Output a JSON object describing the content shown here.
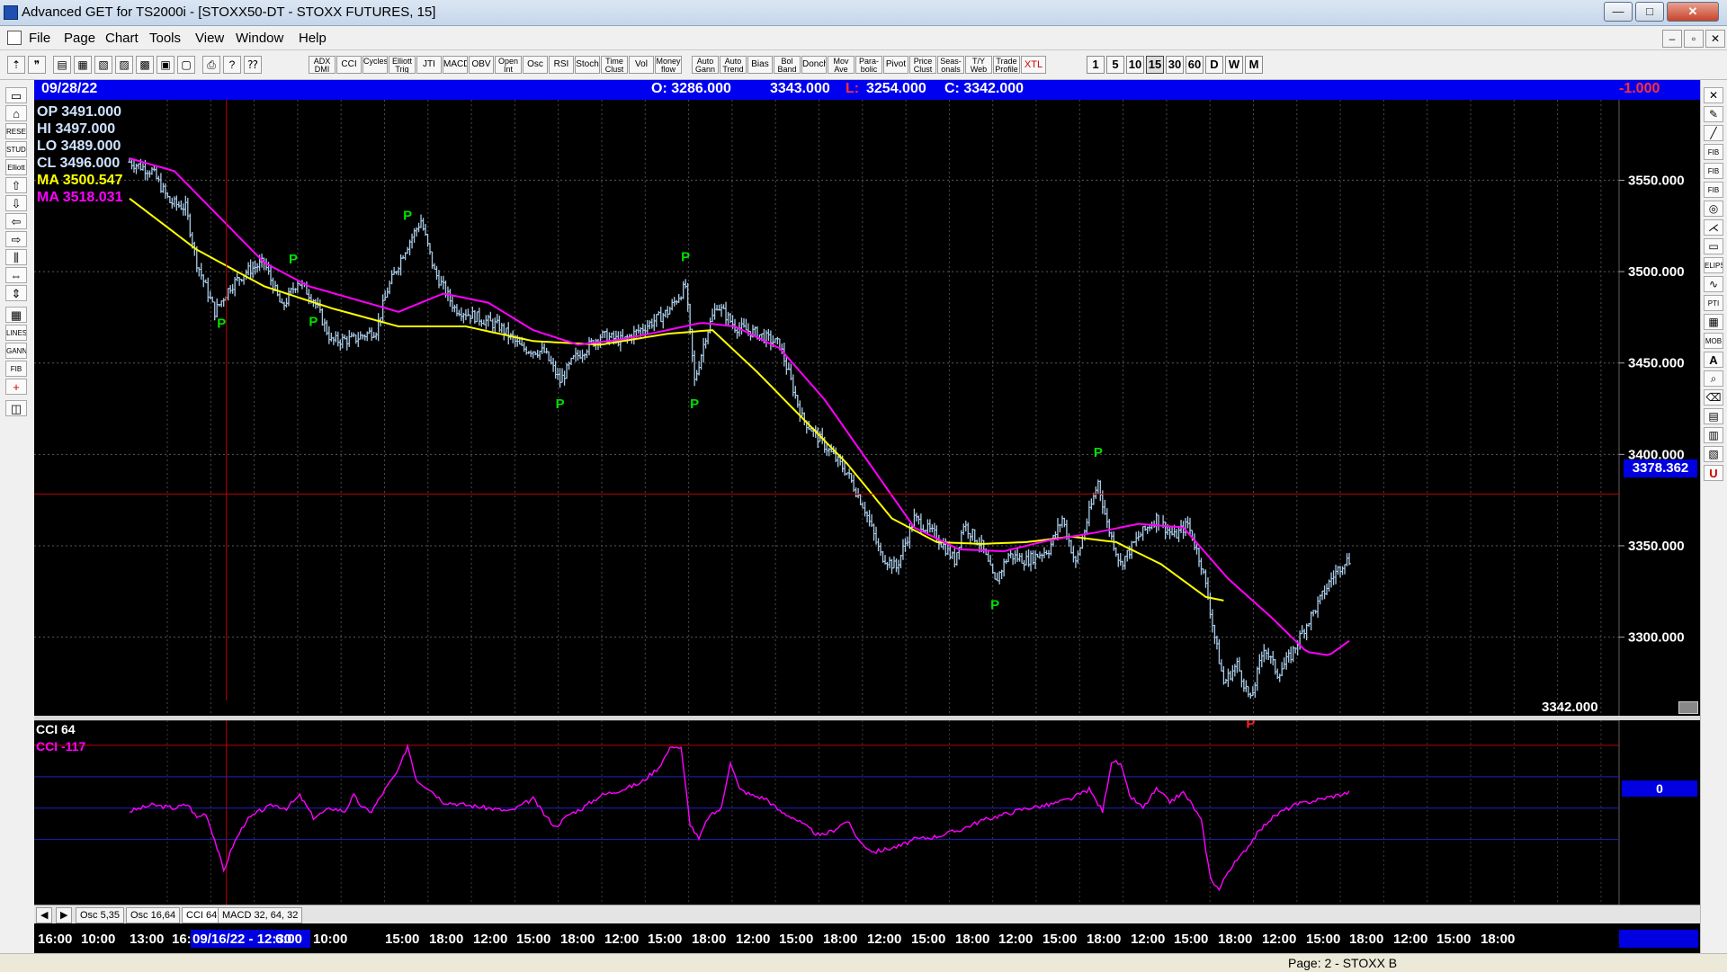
{
  "window": {
    "title": "Advanced GET for TS2000i - [STOXX50-DT - STOXX FUTURES, 15]",
    "minimize": "—",
    "maximize": "□",
    "close": "✕"
  },
  "menu": [
    "File",
    "Page",
    "Chart",
    "Tools",
    "View",
    "Window",
    "Help"
  ],
  "toolbar": {
    "study_buttons": [
      "ADX DMI",
      "CCI",
      "Cycles",
      "Elliott Trig",
      "JTI",
      "MACD",
      "OBV",
      "Open Int",
      "Osc",
      "RSI",
      "Stoch",
      "Time Clust",
      "Vol",
      "Money flow",
      "Auto Gann",
      "Auto Trend",
      "Bias",
      "Bol Band",
      "Donch",
      "Mov Ave",
      "Para- bolic",
      "Pivot",
      "Price Clust",
      "Seas- onals",
      "T/Y Web",
      "Trade Profile",
      "XTL"
    ],
    "periods": [
      "1",
      "5",
      "10",
      "15",
      "30",
      "60",
      "D",
      "W",
      "M"
    ]
  },
  "left_tools": [
    "RESET",
    "STUDY",
    "Elliott",
    "LINES",
    "GANN",
    "FIB"
  ],
  "right_tools": [
    "FIB RET",
    "FIB EXT",
    "FIB TIME",
    "ELIPS",
    "PTI",
    "MOB",
    "A",
    "U"
  ],
  "infobar": {
    "date": "09/28/22",
    "open": "O: 3286.000",
    "high": "3343.000",
    "low_label": "L:",
    "low_value": "3254.000",
    "close": "C: 3342.000",
    "change": "-1.000"
  },
  "legend": {
    "op": "OP 3491.000",
    "hi": "HI  3497.000",
    "lo": "LO  3489.000",
    "cl": "CL  3496.000",
    "ma1": "MA  3500.547",
    "ma2": "MA  3518.031"
  },
  "crosshair_price": "3378.362",
  "last_price": "3342.000",
  "cci": {
    "title": "CCI 64",
    "value": "CCI  -117",
    "zero": "0"
  },
  "tabs": [
    "Osc 5,35",
    "Osc 16,64",
    "CCI 64",
    "MACD 32, 64, 32"
  ],
  "status": "Page: 2 - STOXX B",
  "colors": {
    "bar": "#a9cbe8",
    "ma_fast": "#ffff00",
    "ma_slow": "#ff00ff",
    "pivot_green": "#00e000",
    "pivot_red": "#ff2020",
    "crosshair": "#c00000",
    "cci": "#ff00ff"
  },
  "chart_data": [
    {
      "type": "line",
      "series_kind": "ohlc-bars-15min",
      "y_ticks": [
        "3550.000",
        "3500.000",
        "3450.000",
        "3400.000",
        "3350.000",
        "3300.000"
      ],
      "ylim": [
        3257,
        3594
      ],
      "x_tick_labels": [
        "16:00",
        "10:00",
        "13:00",
        "16:",
        "09/16/22 - 12:30",
        "6:00",
        "10:00",
        "15:00",
        "18:00",
        "12:00",
        "15:00",
        "18:00",
        "12:00",
        "15:00",
        "18:00",
        "12:00",
        "15:00",
        "18:00",
        "12:00",
        "15:00",
        "18:00",
        "12:00",
        "15:00",
        "18:00",
        "12:00",
        "15:00",
        "18:00",
        "12:00",
        "15:00",
        "18:00",
        "12:00",
        "15:00",
        "18:00"
      ],
      "price_anchors": [
        [
          0,
          3560
        ],
        [
          10,
          3555
        ],
        [
          18,
          3538
        ],
        [
          25,
          3535
        ],
        [
          30,
          3505
        ],
        [
          38,
          3478
        ],
        [
          45,
          3492
        ],
        [
          52,
          3500
        ],
        [
          60,
          3505
        ],
        [
          68,
          3480
        ],
        [
          75,
          3495
        ],
        [
          82,
          3485
        ],
        [
          90,
          3462
        ],
        [
          100,
          3463
        ],
        [
          110,
          3468
        ],
        [
          115,
          3490
        ],
        [
          122,
          3510
        ],
        [
          130,
          3528
        ],
        [
          136,
          3500
        ],
        [
          145,
          3480
        ],
        [
          155,
          3475
        ],
        [
          165,
          3470
        ],
        [
          175,
          3458
        ],
        [
          185,
          3456
        ],
        [
          192,
          3440
        ],
        [
          198,
          3452
        ],
        [
          210,
          3465
        ],
        [
          220,
          3462
        ],
        [
          230,
          3470
        ],
        [
          240,
          3478
        ],
        [
          248,
          3492
        ],
        [
          252,
          3440
        ],
        [
          257,
          3465
        ],
        [
          262,
          3482
        ],
        [
          270,
          3470
        ],
        [
          280,
          3466
        ],
        [
          290,
          3460
        ],
        [
          300,
          3420
        ],
        [
          310,
          3405
        ],
        [
          320,
          3390
        ],
        [
          328,
          3370
        ],
        [
          335,
          3345
        ],
        [
          342,
          3338
        ],
        [
          350,
          3365
        ],
        [
          360,
          3355
        ],
        [
          368,
          3342
        ],
        [
          372,
          3362
        ],
        [
          380,
          3350
        ],
        [
          386,
          3330
        ],
        [
          392,
          3345
        ],
        [
          400,
          3342
        ],
        [
          410,
          3348
        ],
        [
          416,
          3365
        ],
        [
          422,
          3340
        ],
        [
          428,
          3368
        ],
        [
          432,
          3385
        ],
        [
          436,
          3362
        ],
        [
          442,
          3340
        ],
        [
          450,
          3355
        ],
        [
          458,
          3365
        ],
        [
          466,
          3355
        ],
        [
          472,
          3362
        ],
        [
          478,
          3340
        ],
        [
          481,
          3322
        ],
        [
          484,
          3300
        ],
        [
          488,
          3275
        ],
        [
          494,
          3285
        ],
        [
          500,
          3265
        ],
        [
          506,
          3295
        ],
        [
          512,
          3280
        ],
        [
          518,
          3290
        ],
        [
          524,
          3305
        ],
        [
          530,
          3318
        ],
        [
          536,
          3332
        ],
        [
          542,
          3342
        ]
      ],
      "ma_fast_anchors": [
        [
          0,
          3540
        ],
        [
          30,
          3512
        ],
        [
          60,
          3492
        ],
        [
          90,
          3480
        ],
        [
          120,
          3470
        ],
        [
          150,
          3470
        ],
        [
          180,
          3462
        ],
        [
          210,
          3460
        ],
        [
          240,
          3466
        ],
        [
          260,
          3468
        ],
        [
          280,
          3445
        ],
        [
          300,
          3420
        ],
        [
          320,
          3395
        ],
        [
          340,
          3365
        ],
        [
          360,
          3352
        ],
        [
          380,
          3351
        ],
        [
          400,
          3352
        ],
        [
          420,
          3355
        ],
        [
          440,
          3352
        ],
        [
          460,
          3340
        ],
        [
          480,
          3322
        ],
        [
          488,
          3320
        ]
      ],
      "ma_slow_anchors": [
        [
          0,
          3562
        ],
        [
          20,
          3555
        ],
        [
          40,
          3530
        ],
        [
          60,
          3505
        ],
        [
          80,
          3492
        ],
        [
          100,
          3485
        ],
        [
          120,
          3478
        ],
        [
          140,
          3488
        ],
        [
          160,
          3483
        ],
        [
          180,
          3468
        ],
        [
          200,
          3460
        ],
        [
          220,
          3463
        ],
        [
          240,
          3468
        ],
        [
          255,
          3472
        ],
        [
          270,
          3470
        ],
        [
          290,
          3458
        ],
        [
          310,
          3430
        ],
        [
          330,
          3395
        ],
        [
          350,
          3360
        ],
        [
          370,
          3348
        ],
        [
          390,
          3347
        ],
        [
          410,
          3353
        ],
        [
          430,
          3357
        ],
        [
          450,
          3362
        ],
        [
          470,
          3360
        ],
        [
          490,
          3332
        ],
        [
          510,
          3310
        ],
        [
          525,
          3292
        ],
        [
          535,
          3290
        ],
        [
          544,
          3298
        ]
      ],
      "pivots": [
        {
          "i": 41,
          "label": "P",
          "pos": "below",
          "color": "green"
        },
        {
          "i": 73,
          "label": "P",
          "pos": "above",
          "color": "green"
        },
        {
          "i": 82,
          "label": "P",
          "pos": "below",
          "color": "green"
        },
        {
          "i": 124,
          "label": "P",
          "pos": "above",
          "color": "green"
        },
        {
          "i": 192,
          "label": "P",
          "pos": "below",
          "color": "green"
        },
        {
          "i": 248,
          "label": "P",
          "pos": "above",
          "color": "green"
        },
        {
          "i": 252,
          "label": "P",
          "pos": "below",
          "color": "green"
        },
        {
          "i": 386,
          "label": "P",
          "pos": "below",
          "color": "green"
        },
        {
          "i": 432,
          "label": "P",
          "pos": "above",
          "color": "green"
        },
        {
          "i": 500,
          "label": "P",
          "pos": "below",
          "color": "red"
        }
      ],
      "crosshair": {
        "bar_index": 40,
        "price": 3378.362
      }
    },
    {
      "type": "line",
      "name": "CCI 64",
      "ylim": [
        -310,
        280
      ],
      "levels": [
        200,
        100,
        0,
        -100
      ],
      "cci_anchors": [
        [
          0,
          -10
        ],
        [
          10,
          10
        ],
        [
          20,
          0
        ],
        [
          26,
          12
        ],
        [
          30,
          -30
        ],
        [
          34,
          -15
        ],
        [
          38,
          -100
        ],
        [
          42,
          -200
        ],
        [
          46,
          -120
        ],
        [
          52,
          -40
        ],
        [
          58,
          -10
        ],
        [
          64,
          10
        ],
        [
          70,
          0
        ],
        [
          76,
          40
        ],
        [
          82,
          -30
        ],
        [
          90,
          0
        ],
        [
          96,
          -10
        ],
        [
          100,
          40
        ],
        [
          104,
          0
        ],
        [
          108,
          -10
        ],
        [
          114,
          60
        ],
        [
          120,
          120
        ],
        [
          124,
          200
        ],
        [
          128,
          90
        ],
        [
          134,
          60
        ],
        [
          140,
          20
        ],
        [
          150,
          10
        ],
        [
          160,
          0
        ],
        [
          170,
          -10
        ],
        [
          180,
          30
        ],
        [
          185,
          -20
        ],
        [
          190,
          -60
        ],
        [
          196,
          -20
        ],
        [
          202,
          0
        ],
        [
          210,
          40
        ],
        [
          220,
          60
        ],
        [
          228,
          80
        ],
        [
          236,
          130
        ],
        [
          242,
          200
        ],
        [
          246,
          190
        ],
        [
          250,
          -50
        ],
        [
          254,
          -100
        ],
        [
          258,
          -30
        ],
        [
          264,
          0
        ],
        [
          268,
          150
        ],
        [
          272,
          60
        ],
        [
          278,
          40
        ],
        [
          284,
          30
        ],
        [
          290,
          -10
        ],
        [
          296,
          -30
        ],
        [
          302,
          -60
        ],
        [
          308,
          -90
        ],
        [
          314,
          -70
        ],
        [
          320,
          -40
        ],
        [
          326,
          -110
        ],
        [
          332,
          -140
        ],
        [
          338,
          -130
        ],
        [
          344,
          -120
        ],
        [
          350,
          -100
        ],
        [
          360,
          -90
        ],
        [
          370,
          -70
        ],
        [
          380,
          -40
        ],
        [
          390,
          -20
        ],
        [
          400,
          0
        ],
        [
          410,
          10
        ],
        [
          420,
          30
        ],
        [
          428,
          60
        ],
        [
          434,
          -10
        ],
        [
          438,
          150
        ],
        [
          442,
          140
        ],
        [
          446,
          40
        ],
        [
          452,
          0
        ],
        [
          458,
          60
        ],
        [
          464,
          20
        ],
        [
          470,
          50
        ],
        [
          474,
          10
        ],
        [
          478,
          -40
        ],
        [
          482,
          -220
        ],
        [
          486,
          -260
        ],
        [
          490,
          -200
        ],
        [
          496,
          -150
        ],
        [
          502,
          -90
        ],
        [
          508,
          -40
        ],
        [
          514,
          -10
        ],
        [
          520,
          10
        ],
        [
          526,
          20
        ],
        [
          532,
          30
        ],
        [
          538,
          40
        ],
        [
          544,
          50
        ]
      ]
    }
  ]
}
